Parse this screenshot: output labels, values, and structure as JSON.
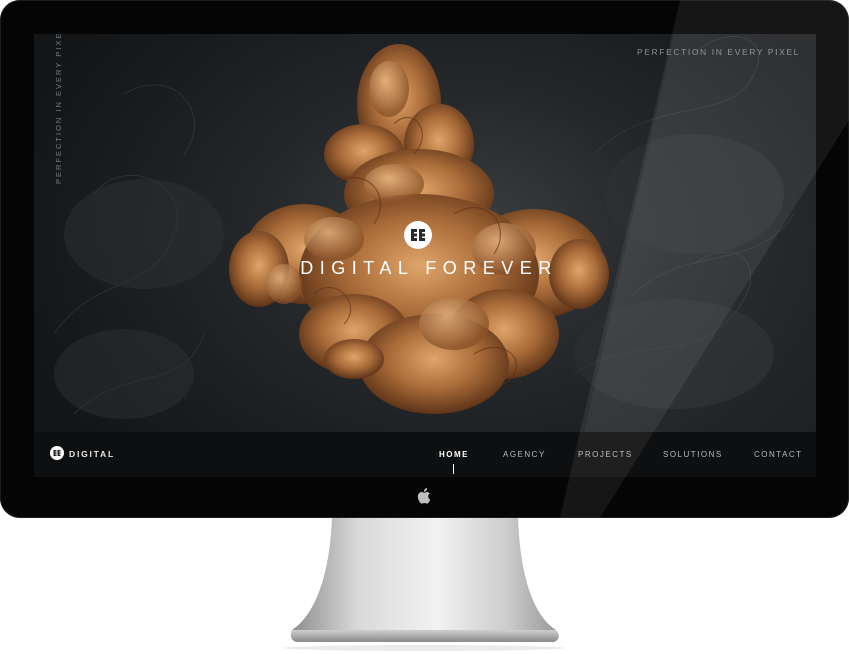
{
  "side_tagline": "PERFECTION IN EVERY PIXEL",
  "top_tagline": "PERFECTION IN EVERY PIXEL",
  "hero": {
    "title": "DIGITAL FOREVER",
    "image_subject": "copper-ink-smoke-cloud"
  },
  "brand": {
    "name": "DIGITAL"
  },
  "nav": {
    "items": [
      {
        "label": "HOME",
        "active": true
      },
      {
        "label": "AGENCY",
        "active": false
      },
      {
        "label": "PROJECTS",
        "active": false
      },
      {
        "label": "SOLUTIONS",
        "active": false
      },
      {
        "label": "CONTACT",
        "active": false
      }
    ]
  },
  "colors": {
    "bezel": "#050505",
    "screen_bg": "#23272a",
    "navbar_bg": "#0e0f10",
    "smoke_copper": "#b07a47",
    "text_light": "#ffffff"
  },
  "device": {
    "logo_icon": "apple-logo-icon"
  }
}
